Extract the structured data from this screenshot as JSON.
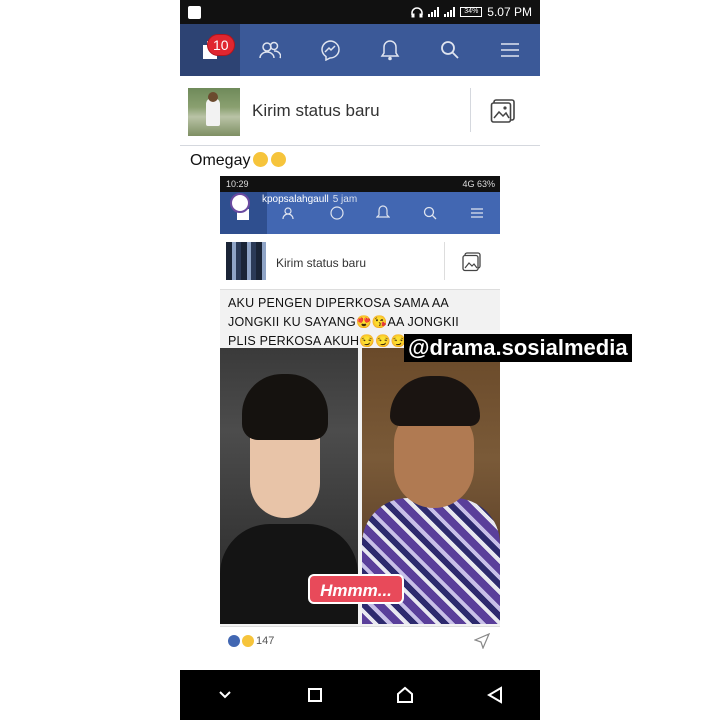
{
  "status_bar": {
    "time": "5.07 PM",
    "battery": "34%"
  },
  "nav": {
    "notification_count": "10",
    "tabs": [
      "home",
      "friends",
      "messenger",
      "notifications",
      "search",
      "menu"
    ]
  },
  "composer": {
    "prompt": "Kirim status baru"
  },
  "post": {
    "caption": "Omegay"
  },
  "shared_image": {
    "status_time": "10:29",
    "status_right": "4G 63%",
    "handle": "kpopsalahgaull",
    "time_ago": "5 jam",
    "composer_prompt": "Kirim status baru",
    "text": "AKU PENGEN DIPERKOSA SAMA AA JONGKII KU SAYANG😍😘AA JONGKII PLIS PERKOSA AKUH😏😏😏",
    "sticker": "Hmmm...",
    "reaction_count": "147"
  },
  "watermark": "@drama.sosialmedia",
  "colors": {
    "fb_blue": "#3b5998",
    "fb_blue_active": "#2d4373",
    "badge_red": "#e0262f"
  },
  "icons": {
    "nav": [
      "home-icon",
      "friends-icon",
      "messenger-icon",
      "bell-icon",
      "search-icon",
      "menu-icon"
    ],
    "system": [
      "back-icon",
      "home-button-icon",
      "recents-icon",
      "chevron-down-icon"
    ]
  }
}
